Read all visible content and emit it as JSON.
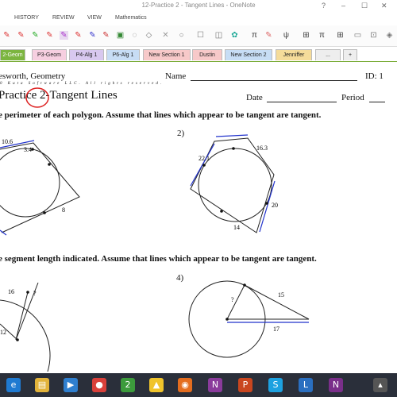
{
  "window": {
    "title": "12-Practice 2 - Tangent Lines - OneNote",
    "help": "?",
    "minimize": "–",
    "restore": "☐",
    "close": "✕"
  },
  "menu": [
    "HISTORY",
    "REVIEW",
    "VIEW",
    "Mathematics"
  ],
  "tabs": [
    {
      "label": "2-Geom",
      "color": "#7bb53f",
      "active": true
    },
    {
      "label": "P3-Geom",
      "color": "#f6cfe0"
    },
    {
      "label": "P4-Alg 1",
      "color": "#d8c8ef"
    },
    {
      "label": "P6-Alg 1",
      "color": "#c7ddf5"
    },
    {
      "label": "New Section 1",
      "color": "#f7c9c9"
    },
    {
      "label": "Dustin",
      "color": "#f7c9c9"
    },
    {
      "label": "New Section 2",
      "color": "#c7ddf5"
    },
    {
      "label": "Jenniffer",
      "color": "#f5dc9a"
    },
    {
      "label": "...",
      "color": "#eeeeee"
    },
    {
      "label": "+",
      "color": "#eeeeee"
    }
  ],
  "ribbon_icons": [
    "pen-red",
    "pen-red",
    "pen-green",
    "pen-red",
    "highlighter-purple",
    "pen-red",
    "pen-blue",
    "image",
    "lasso",
    "shape",
    "eraser",
    "circle",
    "rectangle",
    "note",
    "pi",
    "pen-highlight",
    "math",
    "grid",
    "pi",
    "table",
    "more"
  ],
  "doc": {
    "teacher": "esworth, Geometry",
    "copyright": "0 Kuta Software LLC. All rights reserved.",
    "name_label": "Name",
    "id_label": "ID: 1",
    "title": "Practice 2-Tangent Lines",
    "date_label": "Date",
    "period_label": "Period",
    "instruction1": "e perimeter of each polygon.  Assume that lines which appear to be tangent are tangent.",
    "instruction2": "e segment length indicated.  Assume that lines which appear to be tangent are tangent.",
    "p2_num": "2)",
    "p4_num": "4)",
    "p1_labels": {
      "a": "10.6",
      "b": "3.4",
      "c": "8"
    },
    "p2_labels": {
      "a": "22.1",
      "b": "16.3",
      "c": "20",
      "d": "14"
    },
    "p3_labels": {
      "a": "16",
      "b": "?",
      "c": "12"
    },
    "p4_labels": {
      "a": "?",
      "b": "15",
      "c": "17"
    }
  },
  "taskbar_icons": [
    {
      "name": "ie-icon",
      "glyph": "e",
      "color": "#1f7ad1"
    },
    {
      "name": "file-explorer-icon",
      "glyph": "▤",
      "color": "#e2b33a"
    },
    {
      "name": "media-icon",
      "glyph": "▶",
      "color": "#2f7fcf"
    },
    {
      "name": "chrome-icon",
      "glyph": "●",
      "color": "#d9403a"
    },
    {
      "name": "smart-notebook-icon",
      "glyph": "2",
      "color": "#3c9b3c"
    },
    {
      "name": "google-drive-icon",
      "glyph": "▲",
      "color": "#f0c42b"
    },
    {
      "name": "firefox-icon",
      "glyph": "◉",
      "color": "#e46d1f"
    },
    {
      "name": "onenote-icon",
      "glyph": "N",
      "color": "#8a3b9b"
    },
    {
      "name": "powerpoint-icon",
      "glyph": "P",
      "color": "#c9461f"
    },
    {
      "name": "skype-icon",
      "glyph": "S",
      "color": "#1da1e0"
    },
    {
      "name": "lync-icon",
      "glyph": "L",
      "color": "#2a6fc0"
    },
    {
      "name": "onenote-2-icon",
      "glyph": "N",
      "color": "#7a2f8a"
    },
    {
      "name": "tray-icon",
      "glyph": "▴",
      "color": "#555555"
    }
  ]
}
